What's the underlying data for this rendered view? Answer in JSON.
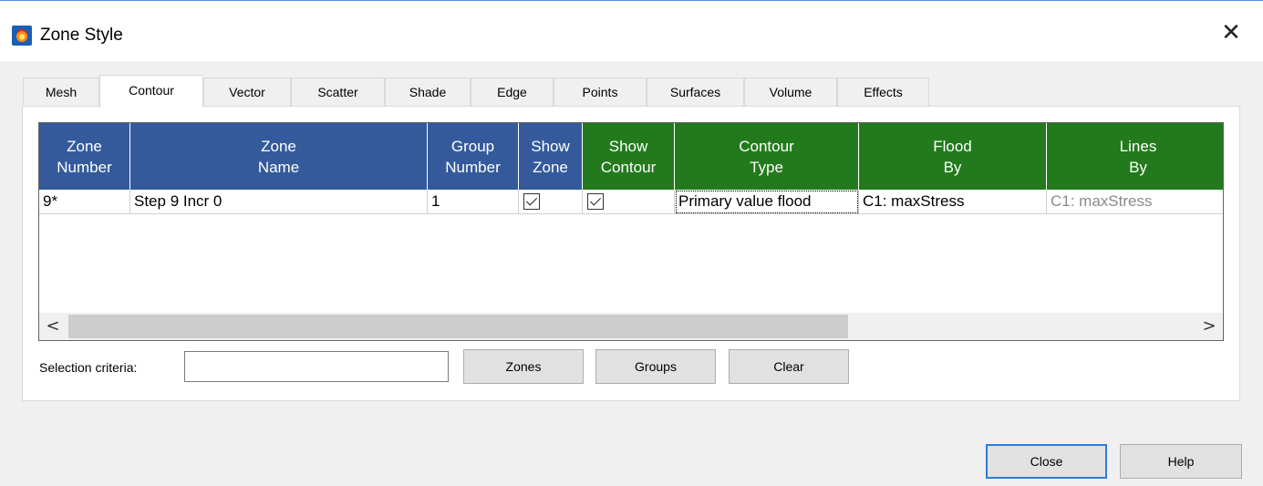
{
  "window": {
    "title": "Zone Style",
    "close_glyph": "✕"
  },
  "tabs": [
    "Mesh",
    "Contour",
    "Vector",
    "Scatter",
    "Shade",
    "Edge",
    "Points",
    "Surfaces",
    "Volume",
    "Effects"
  ],
  "active_tab": "Contour",
  "grid": {
    "columns": [
      {
        "line1": "Zone",
        "line2": "Number",
        "group": "zone"
      },
      {
        "line1": "Zone",
        "line2": "Name",
        "group": "zone"
      },
      {
        "line1": "Group",
        "line2": "Number",
        "group": "zone"
      },
      {
        "line1": "Show",
        "line2": "Zone",
        "group": "zone"
      },
      {
        "line1": "Show",
        "line2": "Contour",
        "group": "contour"
      },
      {
        "line1": "Contour",
        "line2": "Type",
        "group": "contour"
      },
      {
        "line1": "Flood",
        "line2": "By",
        "group": "contour"
      },
      {
        "line1": "Lines",
        "line2": "By",
        "group": "contour"
      }
    ],
    "rows": [
      {
        "zone_number": "9*",
        "zone_name": "Step 9 Incr 0",
        "group_number": "1",
        "show_zone": true,
        "show_contour": true,
        "contour_type": "Primary value flood",
        "flood_by": "C1: maxStress",
        "lines_by": "C1: maxStress"
      }
    ],
    "colors": {
      "zone_header": "#345a9b",
      "contour_header": "#237a1d"
    },
    "scroll_left_glyph": "<",
    "scroll_right_glyph": ">"
  },
  "selection": {
    "label": "Selection criteria:",
    "value": "",
    "zones_button": "Zones",
    "groups_button": "Groups",
    "clear_button": "Clear"
  },
  "footer": {
    "close_button": "Close",
    "help_button": "Help"
  }
}
